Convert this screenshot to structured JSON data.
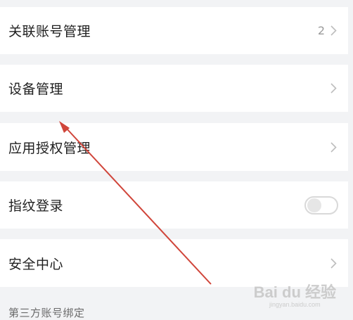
{
  "settings": {
    "items": [
      {
        "label": "关联账号管理",
        "count": "2"
      },
      {
        "label": "设备管理"
      },
      {
        "label": "应用授权管理"
      },
      {
        "label": "指纹登录",
        "toggle_on": false
      },
      {
        "label": "安全中心"
      }
    ],
    "section_title": "第三方账号绑定"
  },
  "icons": {
    "chevron": "chevron-right-icon"
  },
  "colors": {
    "background": "#f2f3f5",
    "row": "#ffffff",
    "arrow": "#d0453a"
  },
  "watermark": {
    "main": "Bai du 经验",
    "sub": "jingyan.baidu.com"
  }
}
